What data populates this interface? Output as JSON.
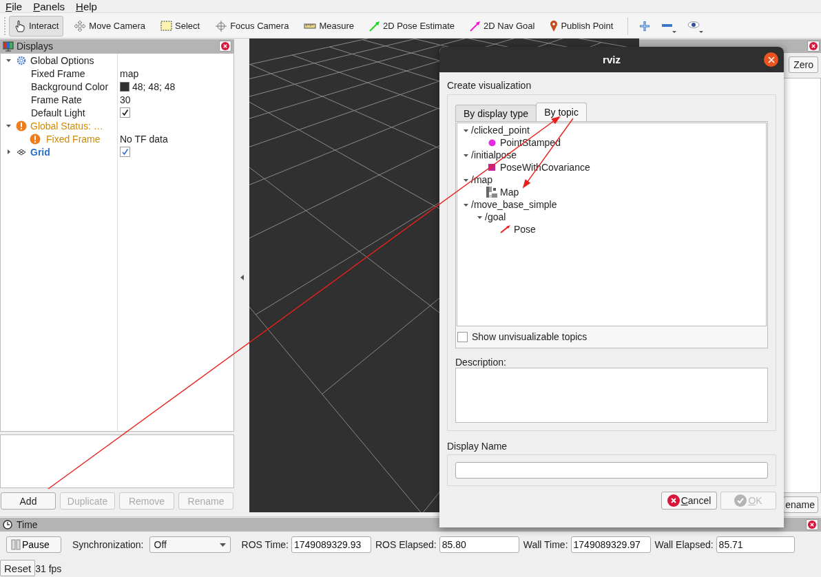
{
  "menu": [
    {
      "label": "File"
    },
    {
      "label": "Panels"
    },
    {
      "label": "Help"
    }
  ],
  "toolbar": {
    "tools": [
      {
        "label": "Interact",
        "kind": "interact",
        "selected": true
      },
      {
        "label": "Move Camera",
        "kind": "move",
        "selected": false
      },
      {
        "label": "Select",
        "kind": "select",
        "selected": false
      },
      {
        "label": "Focus Camera",
        "kind": "focus",
        "selected": false
      },
      {
        "label": "Measure",
        "kind": "measure",
        "selected": false
      },
      {
        "label": "2D Pose Estimate",
        "kind": "pose",
        "selected": false
      },
      {
        "label": "2D Nav Goal",
        "kind": "nav",
        "selected": false
      },
      {
        "label": "Publish Point",
        "kind": "point",
        "selected": false
      }
    ]
  },
  "displays": {
    "title": "Displays",
    "tree": [
      {
        "kind": "group",
        "label": "Global Options",
        "expanded": true,
        "children": [
          {
            "kind": "property",
            "label": "Fixed Frame",
            "value": "map"
          },
          {
            "kind": "property",
            "label": "Background Color",
            "value": "48; 48; 48",
            "color": "#303030"
          },
          {
            "kind": "property",
            "label": "Frame Rate",
            "value": "30"
          },
          {
            "kind": "property",
            "label": "Default Light",
            "checked": true
          }
        ]
      },
      {
        "kind": "status",
        "label": "Global Status: …",
        "expanded": true,
        "children": [
          {
            "kind": "status",
            "label": "Fixed Frame",
            "value": "No TF data"
          }
        ]
      },
      {
        "kind": "display",
        "label": "Grid",
        "expanded": false,
        "checked": true
      }
    ],
    "buttons": [
      {
        "label": "Add",
        "disabled": false
      },
      {
        "label": "Duplicate",
        "disabled": true
      },
      {
        "label": "Remove",
        "disabled": true
      },
      {
        "label": "Rename",
        "disabled": true
      }
    ]
  },
  "views": {
    "buttons": [
      {
        "label": "Zero"
      },
      {
        "label": "ename"
      }
    ]
  },
  "time": {
    "title": "Time",
    "pause": "Pause",
    "sync_label": "Synchronization:",
    "sync_value": "Off",
    "fields": [
      {
        "label": "ROS Time:",
        "value": "1749089329.93"
      },
      {
        "label": "ROS Elapsed:",
        "value": "85.80"
      },
      {
        "label": "Wall Time:",
        "value": "1749089329.97"
      },
      {
        "label": "Wall Elapsed:",
        "value": "85.71"
      }
    ]
  },
  "status_bar": {
    "reset": "Reset",
    "fps": "31 fps"
  },
  "dialog": {
    "title": "rviz",
    "heading": "Create visualization",
    "tabs": [
      {
        "label": "By display type",
        "selected": false
      },
      {
        "label": "By topic",
        "selected": true
      }
    ],
    "topics": [
      {
        "label": "/clicked_point",
        "expanded": true,
        "children": [
          {
            "label": "PointStamped",
            "kind": "point"
          }
        ]
      },
      {
        "label": "/initialpose",
        "expanded": true,
        "children": [
          {
            "label": "PoseWithCovariance",
            "kind": "pose_cov"
          }
        ]
      },
      {
        "label": "/map",
        "expanded": true,
        "children": [
          {
            "label": "Map",
            "kind": "map"
          }
        ]
      },
      {
        "label": "/move_base_simple",
        "expanded": true,
        "children": [
          {
            "label": "/goal",
            "expanded": true,
            "children": [
              {
                "label": "Pose",
                "kind": "pose"
              }
            ]
          }
        ]
      }
    ],
    "show_unvisualizable": {
      "label": "Show unvisualizable topics",
      "checked": false
    },
    "description_label": "Description:",
    "display_name_label": "Display Name",
    "buttons": [
      {
        "label": "Cancel",
        "kind": "cancel",
        "disabled": false
      },
      {
        "label": "OK",
        "kind": "ok",
        "disabled": true
      }
    ]
  }
}
